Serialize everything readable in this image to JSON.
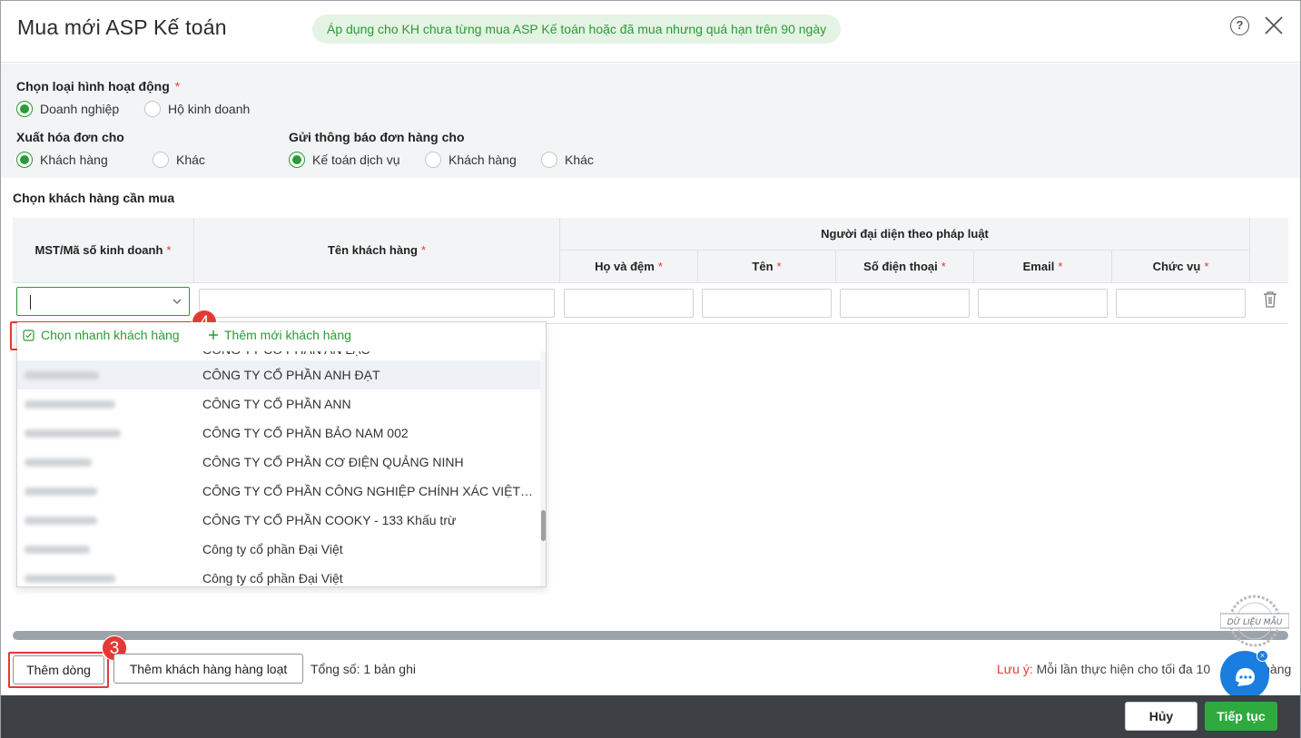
{
  "dialog": {
    "title": "Mua mới ASP Kế toán",
    "notice": "Áp dụng cho KH chưa từng mua ASP Kế toán hoặc đã mua nhưng quá hạn trên 90 ngày"
  },
  "settings": {
    "business_type_label": "Chọn loại hình hoạt động",
    "required_mark": "*",
    "business_type_options": [
      "Doanh nghiệp",
      "Hộ kinh doanh"
    ],
    "business_type_selected": "Doanh nghiệp",
    "invoice_label": "Xuất hóa đơn cho",
    "invoice_options": [
      "Khách hàng",
      "Khác"
    ],
    "invoice_selected": "Khách hàng",
    "notify_label": "Gửi thông báo đơn hàng cho",
    "notify_options": [
      "Kế toán dịch vụ",
      "Khách hàng",
      "Khác"
    ],
    "notify_selected": "Kế toán dịch vụ"
  },
  "section": {
    "title": "Chọn khách hàng cần mua"
  },
  "table": {
    "col_tax_code": "MST/Mã số kinh doanh",
    "col_customer_name": "Tên khách hàng",
    "group_legal_rep": "Người đại diện theo pháp luật",
    "col_last_middle": "Họ và đệm",
    "col_first": "Tên",
    "col_phone": "Số điện thoại",
    "col_email": "Email",
    "col_position": "Chức vụ",
    "required_mark": "*"
  },
  "dropdown": {
    "quick_select": "Chọn nhanh khách hàng",
    "add_new": "Thêm mới khách hàng",
    "partial_top": "CÔNG TY CỔ PHẦN AN LẠC",
    "items": [
      {
        "name": "CÔNG TY CỔ PHẦN ANH ĐẠT"
      },
      {
        "name": "CÔNG TY CỔ PHẦN ANN"
      },
      {
        "name": "CÔNG TY CỔ PHẦN BẢO NAM 002"
      },
      {
        "name": "CÔNG TY CỔ PHẦN CƠ ĐIỆN QUẢNG NINH"
      },
      {
        "name": "CÔNG TY CỔ PHẦN CÔNG NGHIỆP CHÍNH XÁC VIỆT…"
      },
      {
        "name": "CÔNG TY CỔ PHẦN COOKY - 133 Khấu trừ"
      },
      {
        "name": "Công ty cổ phần Đại Việt"
      },
      {
        "name": "Công ty cổ phần Đại Việt"
      }
    ]
  },
  "annotations": {
    "step_dropdown": "4",
    "step_add_row": "3"
  },
  "footer": {
    "add_row": "Thêm dòng",
    "bulk_add": "Thêm khách hàng hàng loạt",
    "total": "Tổng số: 1 bản ghi",
    "note_label": "Lưu ý:",
    "note_text": "Mỗi lần thực hiện cho tối đa 10",
    "note_tail": "hàng",
    "stamp": "DỮ LIỆU MẪU"
  },
  "actions": {
    "cancel": "Hủy",
    "next": "Tiếp tục"
  },
  "colors": {
    "accent": "#2c9a35",
    "danger": "#e53935",
    "chat": "#1a7ee0"
  }
}
